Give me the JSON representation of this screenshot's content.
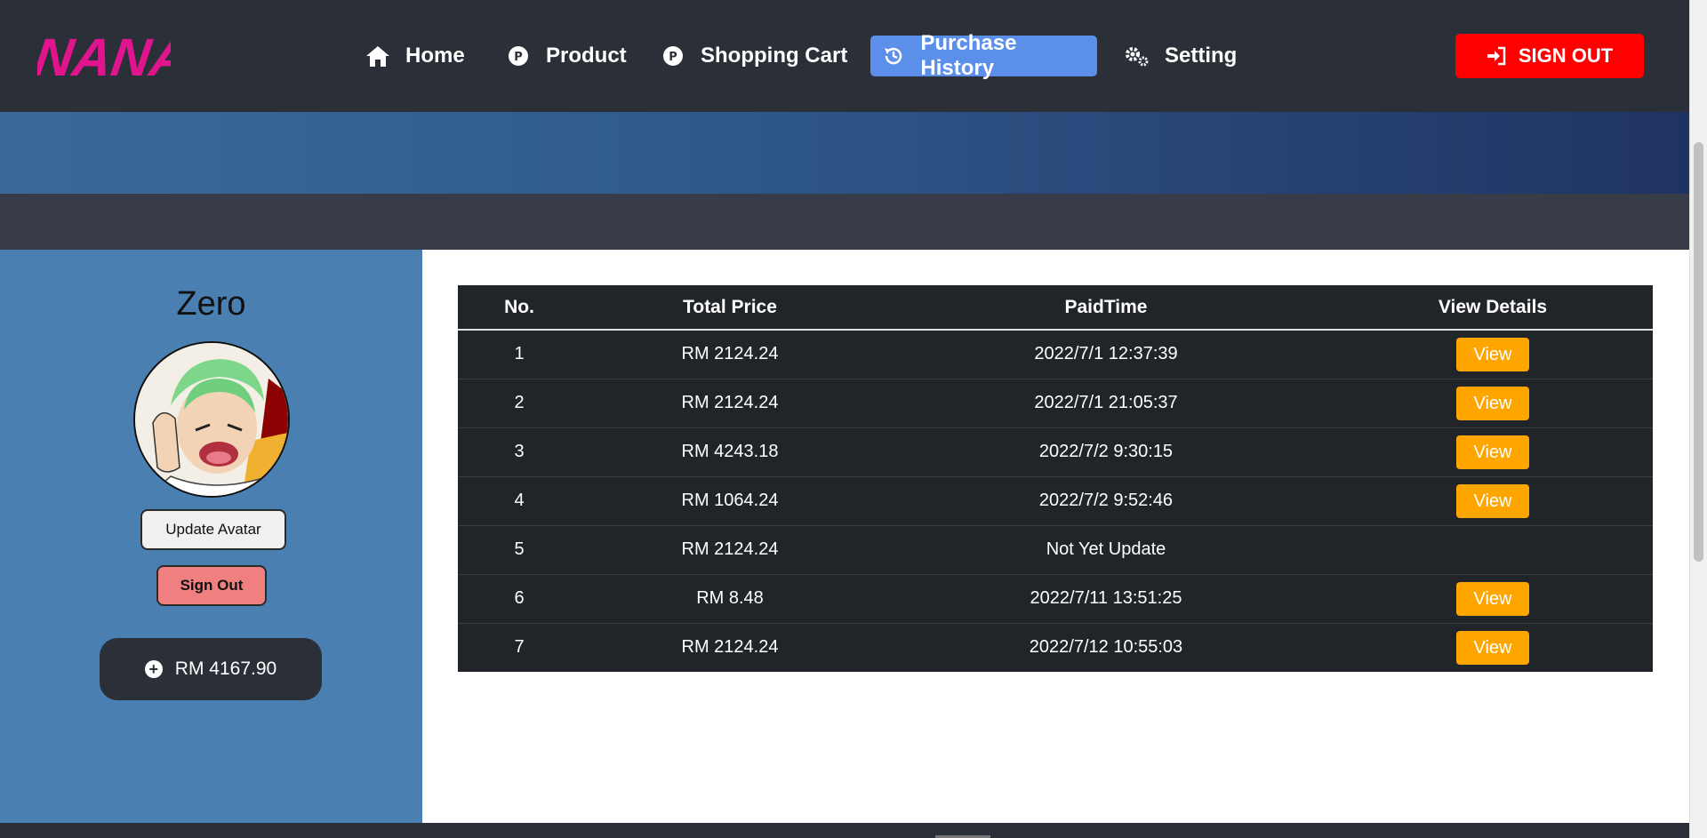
{
  "header": {
    "logo_text": "NANA",
    "nav": [
      {
        "label": "Home",
        "icon": "home-icon"
      },
      {
        "label": "Product",
        "icon": "product-icon"
      },
      {
        "label": "Shopping Cart",
        "icon": "cart-icon"
      },
      {
        "label": "Purchase History",
        "icon": "history-icon",
        "active": true
      },
      {
        "label": "Setting",
        "icon": "gears-icon"
      }
    ],
    "signout_label": "SIGN OUT"
  },
  "profile": {
    "username": "Zero",
    "update_avatar_label": "Update Avatar",
    "signout_label": "Sign Out",
    "balance": "RM 4167.90"
  },
  "history_table": {
    "columns": [
      "No.",
      "Total Price",
      "PaidTime",
      "View Details"
    ],
    "rows": [
      {
        "no": "1",
        "total": "RM 2124.24",
        "paid_time": "2022/7/1 12:37:39",
        "action": "View"
      },
      {
        "no": "2",
        "total": "RM 2124.24",
        "paid_time": "2022/7/1 21:05:37",
        "action": "View"
      },
      {
        "no": "3",
        "total": "RM 4243.18",
        "paid_time": "2022/7/2 9:30:15",
        "action": "View"
      },
      {
        "no": "4",
        "total": "RM 1064.24",
        "paid_time": "2022/7/2 9:52:46",
        "action": "View"
      },
      {
        "no": "5",
        "total": "RM 2124.24",
        "paid_time": "Not Yet Update",
        "action": ""
      },
      {
        "no": "6",
        "total": "RM 8.48",
        "paid_time": "2022/7/11 13:51:25",
        "action": "View"
      },
      {
        "no": "7",
        "total": "RM 2124.24",
        "paid_time": "2022/7/12 10:55:03",
        "action": "View"
      }
    ]
  },
  "colors": {
    "navbar": "#2b3038",
    "active_nav": "#5b8fea",
    "signout": "#ff0000",
    "side_panel": "#4a7fb1",
    "table_bg": "#212529",
    "view_button": "#ffa500",
    "logo": "#e0148c"
  }
}
